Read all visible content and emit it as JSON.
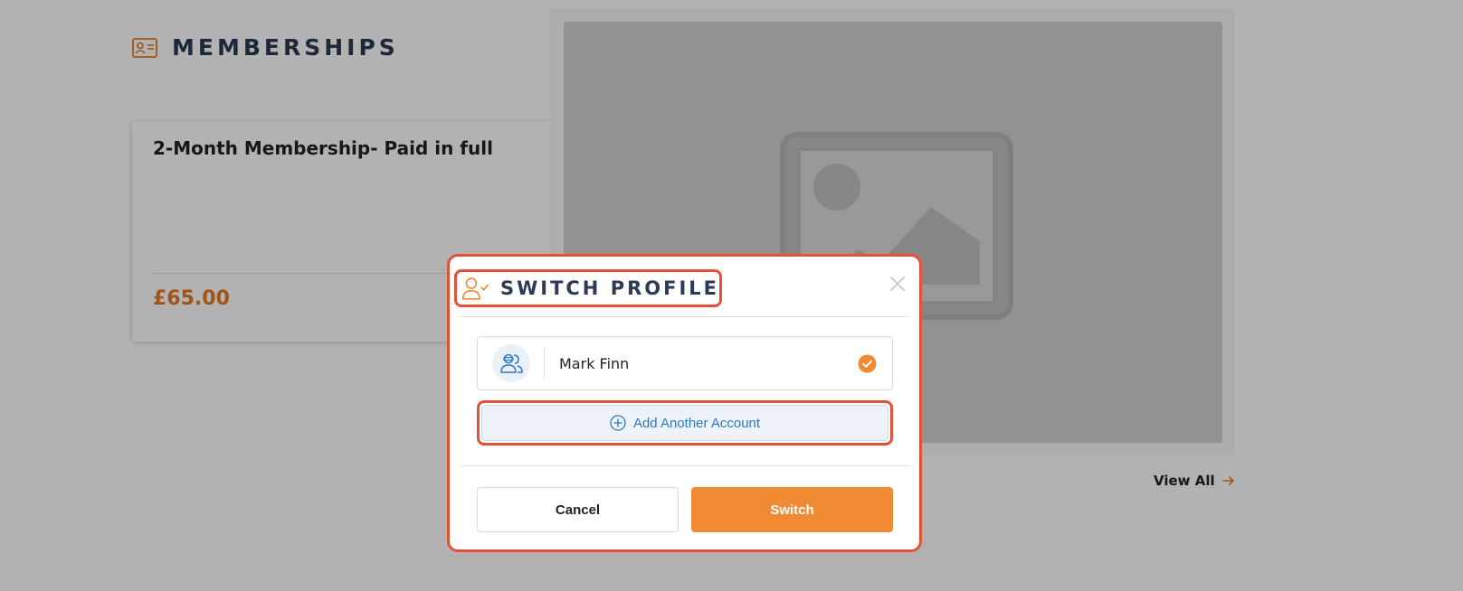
{
  "section": {
    "title": "MEMBERSHIPS",
    "icon": "id-card-icon"
  },
  "membership_card": {
    "title": "2-Month Membership- Paid in full",
    "price": "£65.00",
    "prev_icon": "arrow-left-circle-icon",
    "next_icon": "arrow-right-circle-icon"
  },
  "image_panel": {
    "icon": "image-placeholder-icon"
  },
  "view_all": {
    "label": "View All",
    "icon": "arrow-right-icon"
  },
  "modal": {
    "title": "SWITCH PROFILE",
    "title_icon": "user-check-icon",
    "close_icon": "close-icon",
    "accounts": [
      {
        "name": "Mark Finn",
        "selected": true,
        "icon": "users-icon"
      }
    ],
    "add_account_label": "Add Another Account",
    "add_account_icon": "plus-circle-icon",
    "cancel_label": "Cancel",
    "switch_label": "Switch"
  },
  "colors": {
    "accent": "#f18b33",
    "title": "#2b3a55",
    "link_blue": "#2e78c4",
    "highlight": "#e2513a",
    "overlay": "rgba(0,0,0,0.30)"
  }
}
